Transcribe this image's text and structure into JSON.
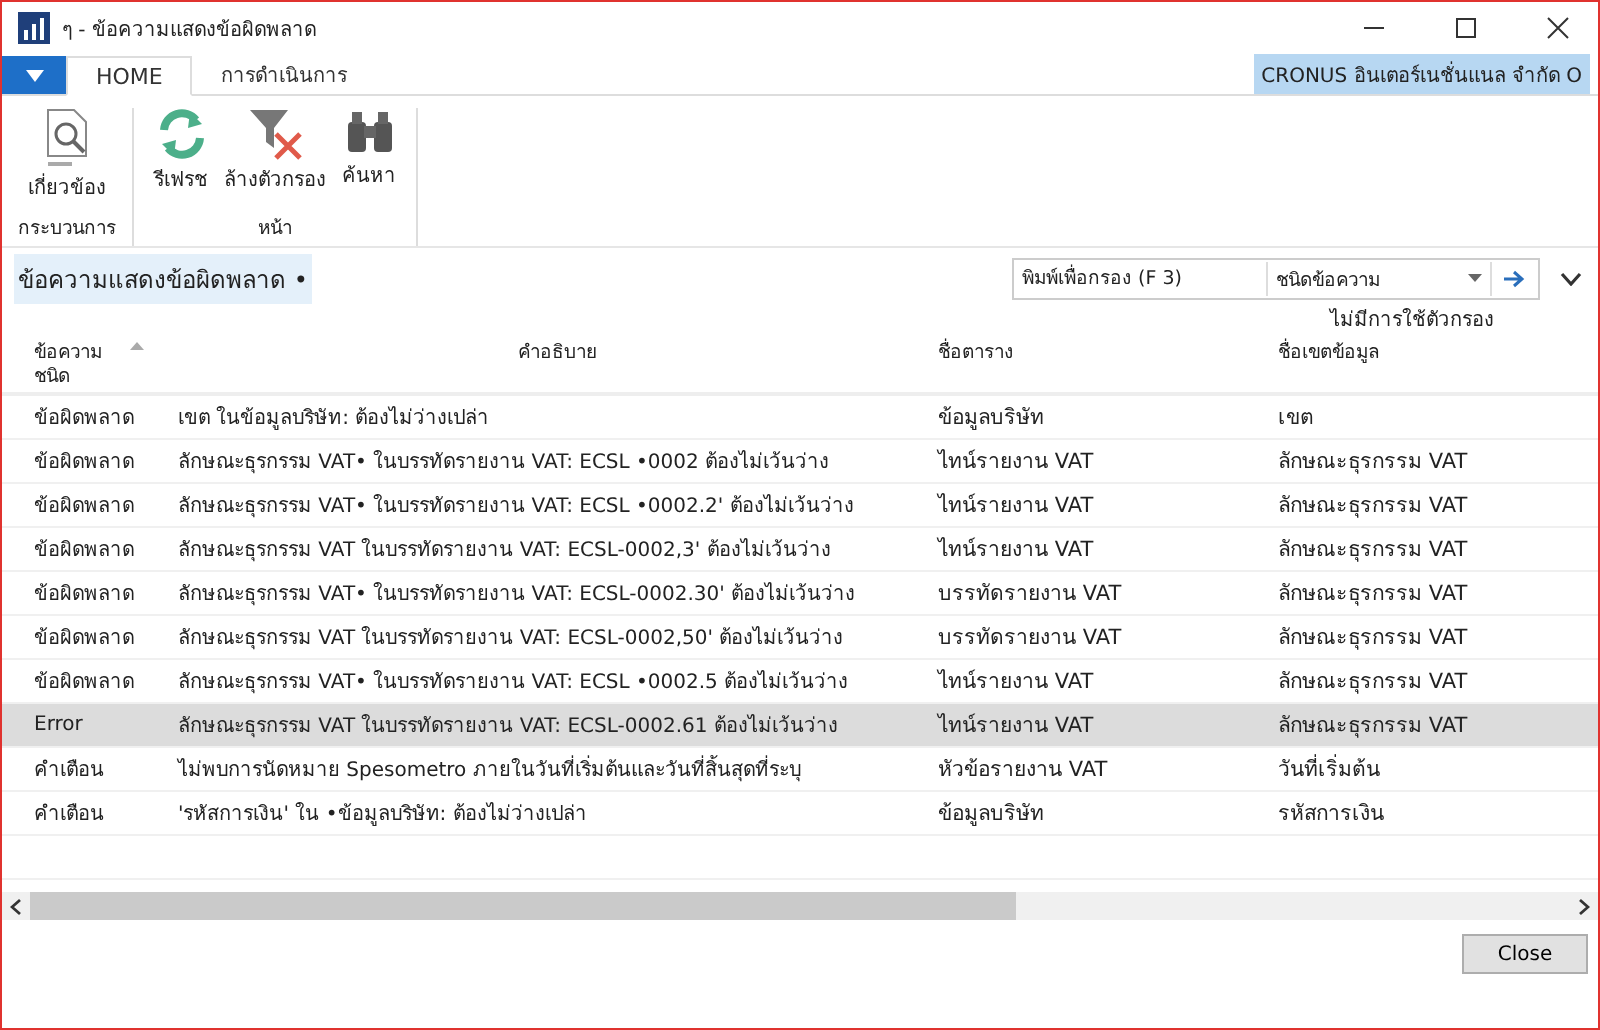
{
  "window": {
    "title": "ๆ - ข้อความแสดงข้อผิดพลาด"
  },
  "tabs": [
    {
      "label": "HOME",
      "selected": true
    },
    {
      "label": "การดำเนินการ",
      "selected": false
    }
  ],
  "company": "CRONUS อินเตอร์เนชั่นแนล จำกัด O",
  "ribbon": {
    "groups": [
      {
        "label": "กระบวนการ",
        "actions": [
          {
            "kind": "document",
            "label": "เกี่ยวข้อง"
          }
        ]
      },
      {
        "label": "หน้า",
        "actions": [
          {
            "kind": "refresh",
            "label": "รีเฟรช"
          },
          {
            "kind": "clear-filter",
            "label": "ล้างตัวกรอง"
          },
          {
            "kind": "find",
            "label": "ค้นหา"
          }
        ]
      }
    ]
  },
  "page_title": "ข้อความแสดงข้อผิดพลาด •",
  "filter": {
    "placeholder": "พิมพ์เพื่อกรอง (F 3)",
    "field": "ชนิดข้อความ"
  },
  "filter_status": "ไม่มีการใช้ตัวกรอง",
  "table": {
    "columns": [
      "ข้อความ ชนิด",
      "คำอธิบาย",
      "ชื่อตาราง",
      "ชื่อเขตข้อมูล"
    ],
    "rows": [
      {
        "selected": false,
        "cells": [
          "ข้อผิดพลาด",
          "เขต ในข้อมูลบริษัท: ต้องไม่ว่างเปล่า",
          "ข้อมูลบริษัท",
          "เขต"
        ]
      },
      {
        "selected": false,
        "cells": [
          "ข้อผิดพลาด",
          "ลักษณะธุรกรรม VAT• ในบรรทัดรายงาน VAT: ECSL •0002 ต้องไม่เว้นว่าง",
          "ไทน์รายงาน VAT",
          "ลักษณะธุรกรรม VAT"
        ]
      },
      {
        "selected": false,
        "cells": [
          "ข้อผิดพลาด",
          "ลักษณะธุรกรรม VAT• ในบรรทัดรายงาน VAT: ECSL •0002.2' ต้องไม่เว้นว่าง",
          "ไทน์รายงาน VAT",
          "ลักษณะธุรกรรม VAT"
        ]
      },
      {
        "selected": false,
        "cells": [
          "ข้อผิดพลาด",
          "ลักษณะธุรกรรม VAT ในบรรทัดรายงาน VAT: ECSL-0002,3' ต้องไม่เว้นว่าง",
          "ไทน์รายงาน VAT",
          "ลักษณะธุรกรรม VAT"
        ]
      },
      {
        "selected": false,
        "cells": [
          "ข้อผิดพลาด",
          "ลักษณะธุรกรรม VAT• ในบรรทัดรายงาน VAT: ECSL-0002.30' ต้องไม่เว้นว่าง",
          "บรรทัดรายงาน VAT",
          "ลักษณะธุรกรรม VAT"
        ]
      },
      {
        "selected": false,
        "cells": [
          "ข้อผิดพลาด",
          "ลักษณะธุรกรรม VAT ในบรรทัดรายงาน VAT: ECSL-0002,50' ต้องไม่เว้นว่าง",
          "บรรทัดรายงาน VAT",
          "ลักษณะธุรกรรม VAT"
        ]
      },
      {
        "selected": false,
        "cells": [
          "ข้อผิดพลาด",
          "ลักษณะธุรกรรม VAT• ในบรรทัดรายงาน VAT: ECSL •0002.5 ต้องไม่เว้นว่าง",
          "ไทน์รายงาน VAT",
          "ลักษณะธุรกรรม VAT"
        ]
      },
      {
        "selected": true,
        "cells": [
          "Error",
          "ลักษณะธุรกรรม VAT ในบรรทัดรายงาน VAT: ECSL-0002.61 ต้องไม่เว้นว่าง",
          "ไทน์รายงาน VAT",
          "ลักษณะธุรกรรม VAT"
        ]
      },
      {
        "selected": false,
        "cells": [
          "คำเตือน",
          "ไม่พบการนัดหมาย Spesometro ภายในวันที่เริ่มต้นและวันที่สิ้นสุดที่ระบุ",
          "หัวข้อรายงาน VAT",
          "วันที่เริ่มต้น"
        ]
      },
      {
        "selected": false,
        "cells": [
          "คำเตือน",
          "'รหัสการเงิน' ใน •ข้อมูลบริษัท: ต้องไม่ว่างเปล่า",
          "ข้อมูลบริษัท",
          "รหัสการเงิน"
        ]
      }
    ]
  },
  "close_button": "Close"
}
